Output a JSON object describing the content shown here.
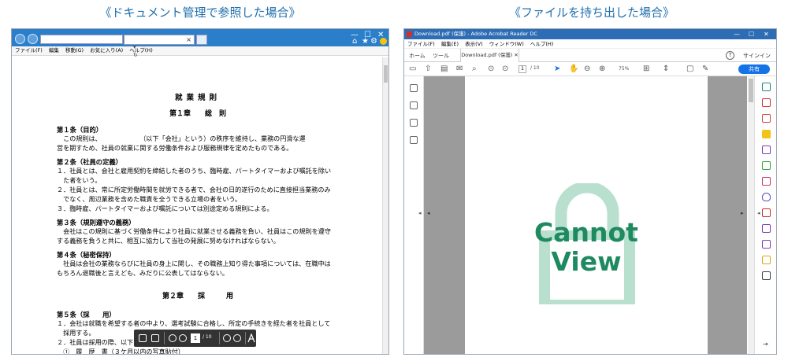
{
  "captions": {
    "left": "《ドキュメント管理で参照した場合》",
    "right": "《ファイルを持ち出した場合》"
  },
  "ie": {
    "menu": [
      "ファイル(F)",
      "編集",
      "移動(G)",
      "お気に入り(A)",
      "ヘルプ(H)"
    ],
    "addr_icons": "ρ ▾ ↻",
    "win_controls": [
      "—",
      "☐",
      "✕"
    ],
    "toolbar_icons": [
      "⌂",
      "★",
      "⚙"
    ],
    "doc": {
      "title": "就業規則",
      "chapter1": "第１章　　総　則",
      "a1_head": "第１条（目的）",
      "a1_l1": "　この規則は、　　　　　　　（以下「会社」という）の秩序を維持し、業務の円滑な運",
      "a1_l2": "営を期すため、社員の就業に関する労働条件および服務規律を定めたものである。",
      "a2_head": "第２条（社員の定義）",
      "a2_l1": "１．社員とは、会社と雇用契約を締結した者のうち、臨時雇、パートタイマーおよび嘱託を除い",
      "a2_l2": "　た者をいう。",
      "a2_l3": "２．社員とは、常に所定労働時間を就労できる者で、会社の日的遂行のために直接担当業務のみ",
      "a2_l4": "　でなく、周辺業務を含めた職責を全うできる立場の者をいう。",
      "a2_l5": "３．臨時雇、パートタイマーおよび嘱託については別途定める規則による。",
      "a3_head": "第３条（規則遵守の義務）",
      "a3_l1": "　会社はこの規則に基づく労働条件により社員に就業させる義務を負い、社員はこの規則を遵守",
      "a3_l2": "する義務を負うと共に、相互に協力して当社の発展に努めなければならない。",
      "a4_head": "第４条（秘密保持）",
      "a4_l1": "　社員は会社の業務ならびに社員の身上に関し、その職務上知り得た事項については、在職中は",
      "a4_l2": "もちろん退職後と言えども、みだりに公表してはならない。",
      "chapter2": "第２章　　採　　　用",
      "a5_head": "第５条（採　　用）",
      "a5_l1": "１．会社は就職を希望する者の中より、選考試験に合格し、所定の手続きを経た者を社員として",
      "a5_l2": "　採用する。",
      "a5_l3": "２．社員は採用の際、以下",
      "a5_l4": "　①　履　歴　書（３ケ月以内の写真貼付）"
    },
    "pdfbar": {
      "page": "1",
      "total": "/ 10"
    }
  },
  "acrobat": {
    "title": "Download.pdf (保護) - Adobe Acrobat Reader DC",
    "menu": [
      "ファイル(F)",
      "編集(E)",
      "表示(V)",
      "ウィンドウ(W)",
      "ヘルプ(H)"
    ],
    "tabs": {
      "home": "ホーム",
      "tools": "ツール",
      "file": "Download.pdf (保護)",
      "close": "✕"
    },
    "help": "?",
    "signin": "サインイン",
    "page": "1",
    "total": "/ 10",
    "zoom": "75%",
    "share": "共有",
    "win_controls": [
      "—",
      "☐",
      "✕"
    ],
    "overlay": {
      "line1": "Cannot",
      "line2": "View"
    },
    "colors": {
      "lock": "#b9dfcf",
      "text": "#1e8a5f",
      "accent": "#1473e6"
    }
  }
}
